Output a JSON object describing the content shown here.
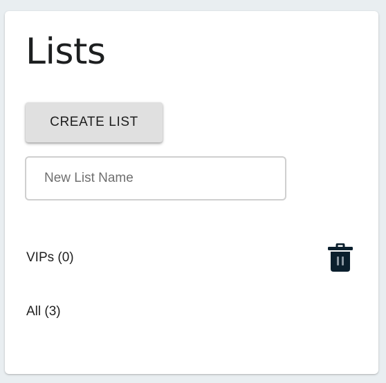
{
  "page": {
    "title": "Lists"
  },
  "actions": {
    "create_label": "CREATE LIST"
  },
  "new_list": {
    "placeholder": "New List Name",
    "value": ""
  },
  "lists": [
    {
      "label": "VIPs (0)",
      "name": "VIPs",
      "count": 0,
      "deletable": true
    },
    {
      "label": "All (3)",
      "name": "All",
      "count": 3,
      "deletable": false
    }
  ],
  "icons": {
    "delete": "trash-icon"
  },
  "colors": {
    "background": "#e9eef1",
    "card": "#ffffff",
    "button": "#e0e0e0",
    "trash_icon": "#0b1f2d"
  }
}
